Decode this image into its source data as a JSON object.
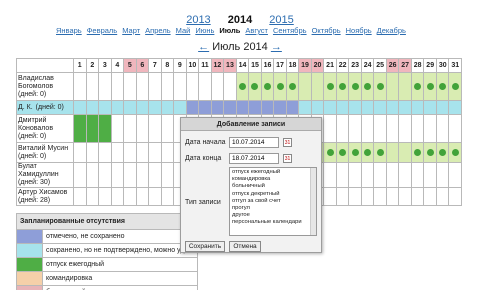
{
  "years": {
    "prev": "2013",
    "current": "2014",
    "next": "2015"
  },
  "months": [
    {
      "label": "Январь",
      "current": false
    },
    {
      "label": "Февраль",
      "current": false
    },
    {
      "label": "Март",
      "current": false
    },
    {
      "label": "Апрель",
      "current": false
    },
    {
      "label": "Май",
      "current": false
    },
    {
      "label": "Июнь",
      "current": false
    },
    {
      "label": "Июль",
      "current": true
    },
    {
      "label": "Август",
      "current": false
    },
    {
      "label": "Сентябрь",
      "current": false
    },
    {
      "label": "Октябрь",
      "current": false
    },
    {
      "label": "Ноябрь",
      "current": false
    },
    {
      "label": "Декабрь",
      "current": false
    }
  ],
  "month_nav": {
    "prev_arrow": "←",
    "title": "Июль 2014",
    "next_arrow": "→"
  },
  "days": [
    "1",
    "2",
    "3",
    "4",
    "5",
    "6",
    "7",
    "8",
    "9",
    "10",
    "11",
    "12",
    "13",
    "14",
    "15",
    "16",
    "17",
    "18",
    "19",
    "20",
    "21",
    "22",
    "23",
    "24",
    "25",
    "26",
    "27",
    "28",
    "29",
    "30",
    "31"
  ],
  "weekend_days": [
    5,
    6,
    12,
    13,
    19,
    20,
    26,
    27
  ],
  "employees": [
    {
      "name_line1": "Владислав",
      "name_line2": "Богомолов",
      "days_line": "(дней: 0)"
    },
    {
      "name_line1": "Д. К.",
      "name_line2": "",
      "days_line": "(дней: 0)"
    },
    {
      "name_line1": "Дмитрий",
      "name_line2": "Коновалов",
      "days_line": "(дней: 0)"
    },
    {
      "name_line1": "Виталий Мусин",
      "name_line2": "",
      "days_line": "(дней: 0)"
    },
    {
      "name_line1": "Булат",
      "name_line2": "Хамидуллин",
      "days_line": "(дней: 30)"
    },
    {
      "name_line1": "Артур Хисамов",
      "name_line2": "",
      "days_line": "(дней: 28)"
    }
  ],
  "legend": {
    "header": "Запланированные отсутствия",
    "items": [
      {
        "label": "отмечено, не сохранено",
        "color": "#8e9ed8"
      },
      {
        "label": "сохранено, но не подтверждено, можно уд",
        "color": "#a7e3ec"
      },
      {
        "label": "отпуск ежегодный",
        "color": "#4fae45"
      },
      {
        "label": "командировка",
        "color": "#f5d0a9"
      },
      {
        "label": "больничный",
        "color": "#e8b4b8"
      }
    ]
  },
  "modal": {
    "title": "Добавление записи",
    "start_label": "Дата начала",
    "start_value": "10.07.2014",
    "end_label": "Дата конца",
    "end_value": "18.07.2014",
    "type_label": "Тип записи",
    "type_options": [
      "отпуск ежегодный",
      "командировка",
      "больничный",
      "отпуск декретный",
      "отгул за свой счет",
      "прогул",
      "другое",
      "персональные календари"
    ],
    "save_label": "Сохранить",
    "cancel_label": "Отмена"
  },
  "colors": {
    "link": "#2b6cb0",
    "weekend": "#f0b6bd",
    "workday": "#d9ecb2",
    "vacation": "#4fae45",
    "selected": "#8e9ed8",
    "saved": "#a7e3ec"
  }
}
